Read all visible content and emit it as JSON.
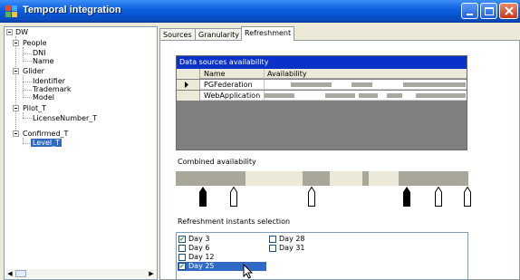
{
  "window": {
    "title": "Temporal integration",
    "colors": {
      "titlebar": "#0a5fe0",
      "selection": "#316ac5",
      "grid_caption": "#0a32c8",
      "availability": "#a8a8a0"
    }
  },
  "tree": {
    "root": "DW",
    "groups": [
      {
        "label": "People",
        "children": [
          "DNI",
          "Name"
        ]
      },
      {
        "label": "Glider",
        "children": [
          "Identifier",
          "Trademark",
          "Model"
        ]
      },
      {
        "label": "Pilot_T",
        "children": [
          "LicenseNumber_T"
        ]
      },
      {
        "label": "Confirmed_T",
        "children": [
          "Level_T"
        ]
      }
    ],
    "selected": "Level_T"
  },
  "tabs": [
    {
      "label": "Sources",
      "active": false
    },
    {
      "label": "Granularity",
      "active": false
    },
    {
      "label": "Refreshment",
      "active": true
    }
  ],
  "data_sources": {
    "caption": "Data sources availability",
    "columns": [
      "Name",
      "Availability"
    ],
    "rows": [
      {
        "name": "PGFederation",
        "current": true
      },
      {
        "name": "WebApplication",
        "current": false
      }
    ]
  },
  "combined": {
    "label": "Combined availability"
  },
  "refreshment": {
    "label": "Refreshment instants selection",
    "days": [
      {
        "label": "Day 3",
        "checked": true,
        "selected": false
      },
      {
        "label": "Day 6",
        "checked": false,
        "selected": false
      },
      {
        "label": "Day 12",
        "checked": false,
        "selected": false
      },
      {
        "label": "Day 25",
        "checked": true,
        "selected": true
      },
      {
        "label": "Day 28",
        "checked": false,
        "selected": false
      },
      {
        "label": "Day 31",
        "checked": false,
        "selected": false
      }
    ]
  },
  "icons": [
    "app-icon",
    "minimize-icon",
    "maximize-icon",
    "close-icon",
    "filled-marker-icon",
    "hollow-marker-icon",
    "mouse-cursor-icon"
  ]
}
